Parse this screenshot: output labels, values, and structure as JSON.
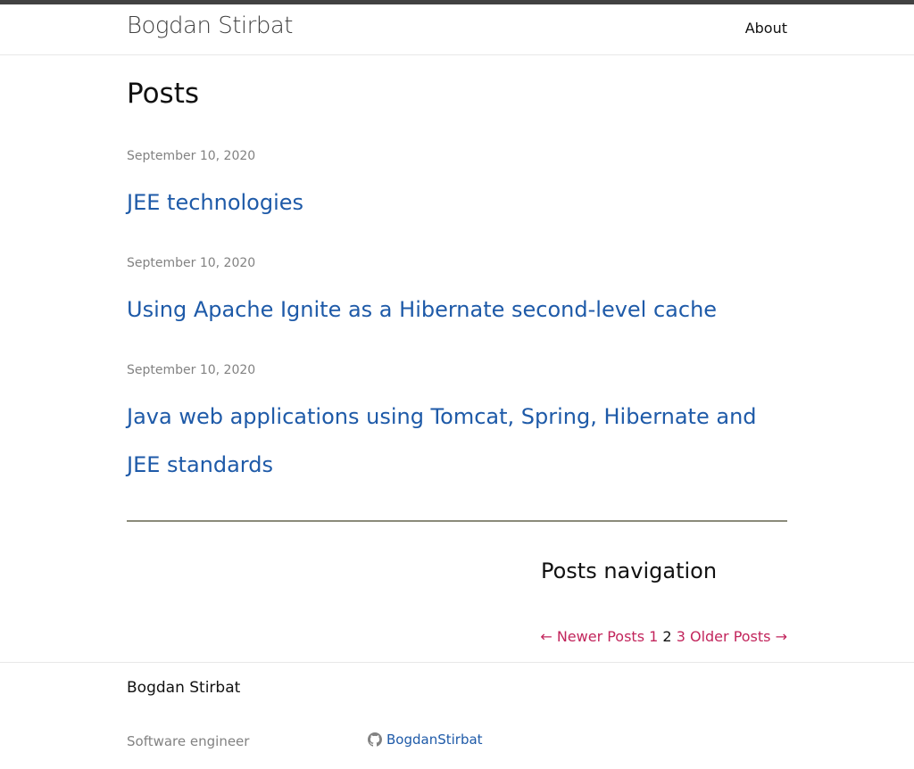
{
  "header": {
    "site_title": "Bogdan Stirbat",
    "nav": [
      {
        "label": "About"
      }
    ]
  },
  "main": {
    "heading": "Posts",
    "posts": [
      {
        "date": "September 10, 2020",
        "title": "JEE technologies"
      },
      {
        "date": "September 10, 2020",
        "title": "Using Apache Ignite as a Hibernate second-level cache"
      },
      {
        "date": "September 10, 2020",
        "title": "Java web applications using Tomcat, Spring, Hibernate and JEE standards"
      }
    ]
  },
  "pagination": {
    "heading": "Posts navigation",
    "newer_label": "← Newer Posts",
    "pages": [
      "1",
      "2",
      "3"
    ],
    "current_page": "2",
    "older_label": "Older Posts →"
  },
  "footer": {
    "name": "Bogdan Stirbat",
    "description": "Software engineer",
    "github_username": "BogdanStirbat",
    "github_icon": "github-icon"
  },
  "colors": {
    "link": "#1e5aa8",
    "pagination_link": "#c2255c",
    "meta": "#828282",
    "top_bar": "#424242"
  }
}
